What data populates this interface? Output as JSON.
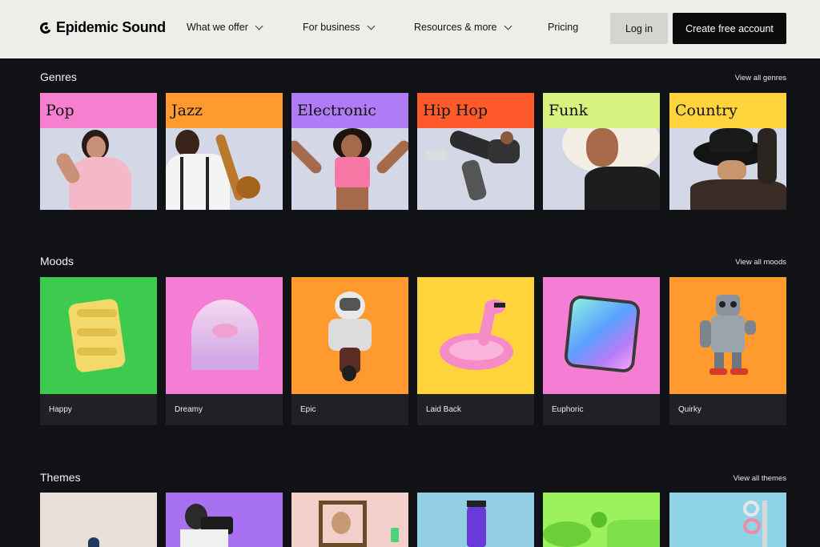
{
  "header": {
    "logo_text": "Epidemic Sound",
    "nav": [
      "What we offer",
      "For business",
      "Resources & more",
      "Pricing"
    ],
    "login": "Log in",
    "create": "Create free account"
  },
  "genres": {
    "title": "Genres",
    "view_all": "View all genres",
    "items": [
      {
        "label": "Pop",
        "color": "#f77fd0"
      },
      {
        "label": "Jazz",
        "color": "#ff9a2e"
      },
      {
        "label": "Electronic",
        "color": "#b07cf5"
      },
      {
        "label": "Hip Hop",
        "color": "#ff5a2b"
      },
      {
        "label": "Funk",
        "color": "#d7f27f"
      },
      {
        "label": "Country",
        "color": "#ffd43d"
      }
    ]
  },
  "moods": {
    "title": "Moods",
    "view_all": "View all moods",
    "items": [
      {
        "label": "Happy",
        "color": "#3ec94f"
      },
      {
        "label": "Dreamy",
        "color": "#f47ed3"
      },
      {
        "label": "Epic",
        "color": "#ff9a2e"
      },
      {
        "label": "Laid Back",
        "color": "#ffd43d"
      },
      {
        "label": "Euphoric",
        "color": "#f47ed3"
      },
      {
        "label": "Quirky",
        "color": "#ff9a2e"
      }
    ]
  },
  "themes": {
    "title": "Themes",
    "view_all": "View all themes",
    "colors": [
      "#e8e0d8",
      "#a871f2",
      "#f3cfc9",
      "#92cfe3",
      "#9cf25c",
      "#8fd4e6"
    ]
  }
}
